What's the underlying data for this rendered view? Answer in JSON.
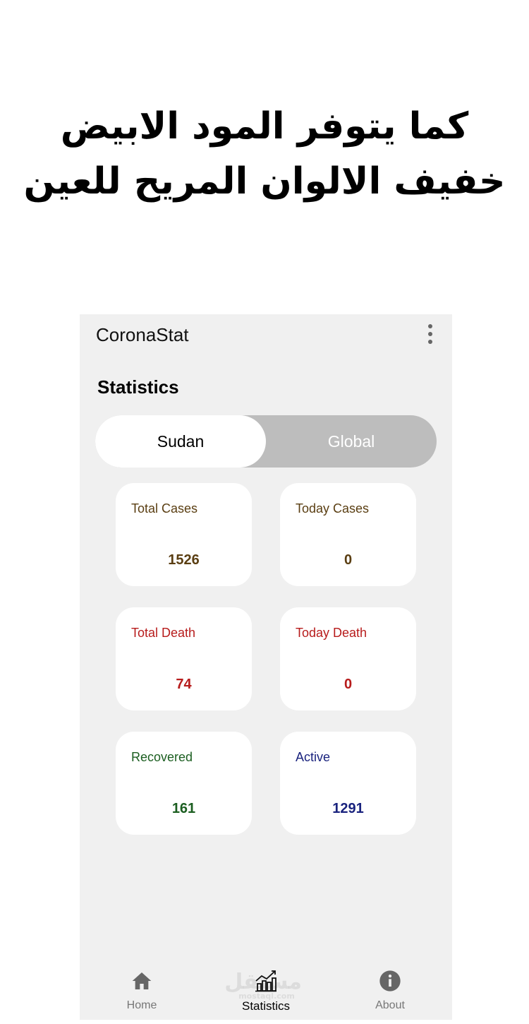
{
  "promo": {
    "line1": "كما يتوفر المود الابيض",
    "line2": "خفيف الالوان المريح للعين"
  },
  "appbar": {
    "title": "CoronaStat",
    "menu_icon": "more-vert-icon"
  },
  "section_title": "Statistics",
  "toggle": {
    "selected": "Sudan",
    "other": "Global"
  },
  "cards": [
    {
      "label": "Total Cases",
      "value": "1526",
      "color": "#5a3e12"
    },
    {
      "label": "Today Cases",
      "value": "0",
      "color": "#5a3e12"
    },
    {
      "label": "Total Death",
      "value": "74",
      "color": "#b71c1c"
    },
    {
      "label": "Today Death",
      "value": "0",
      "color": "#b71c1c"
    },
    {
      "label": "Recovered",
      "value": "161",
      "color": "#1b5e20"
    },
    {
      "label": "Active",
      "value": "1291",
      "color": "#1a237e"
    }
  ],
  "nav": [
    {
      "label": "Home",
      "icon": "home-icon"
    },
    {
      "label": "Statistics",
      "icon": "chart-icon",
      "selected": true
    },
    {
      "label": "About",
      "icon": "info-icon"
    }
  ],
  "watermark": {
    "text": "مستقل",
    "sub": "mostaql.com"
  }
}
